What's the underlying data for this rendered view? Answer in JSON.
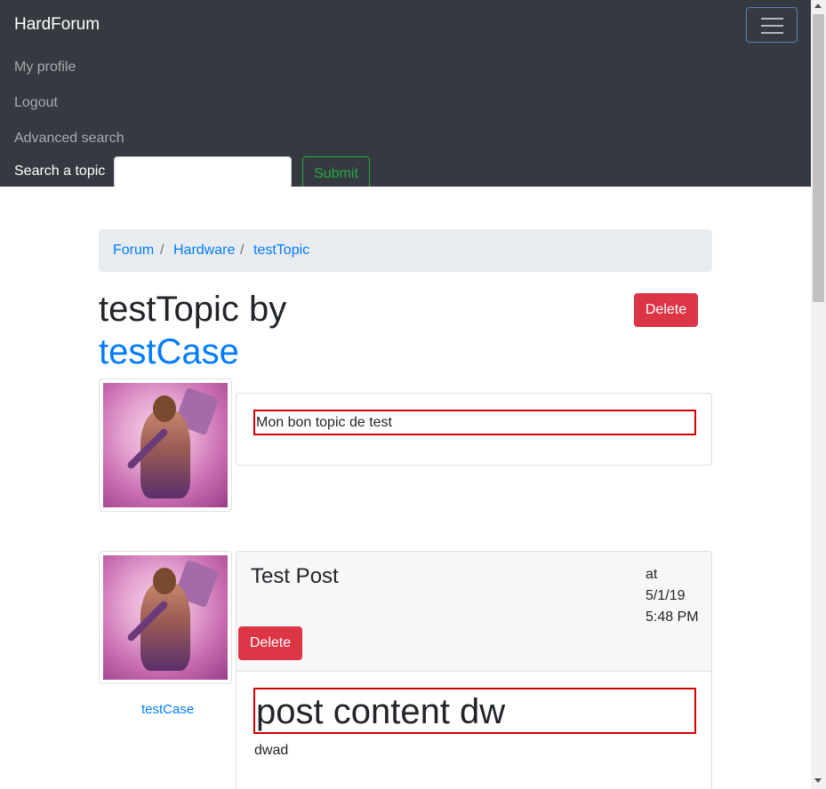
{
  "navbar": {
    "brand": "HardForum",
    "links": [
      "My profile",
      "Logout",
      "Advanced search"
    ],
    "search_label": "Search a topic",
    "search_value": "",
    "submit_label": "Submit"
  },
  "breadcrumb": {
    "items": [
      "Forum",
      "Hardware",
      "testTopic"
    ],
    "separator": "/"
  },
  "topic": {
    "title": "testTopic by",
    "author": "testCase",
    "delete_label": "Delete",
    "content": "Mon bon topic de test"
  },
  "post": {
    "title": "Test Post",
    "date_lines": [
      "at",
      "5/1/19",
      "5:48 PM"
    ],
    "delete_label": "Delete",
    "content_heading": "post content dw",
    "content_text": "dwad",
    "author": "testCase"
  },
  "colors": {
    "navbar_bg": "#343a40",
    "link": "#007bff",
    "danger": "#dc3545",
    "success": "#28a745",
    "highlight_border": "#d00000"
  }
}
